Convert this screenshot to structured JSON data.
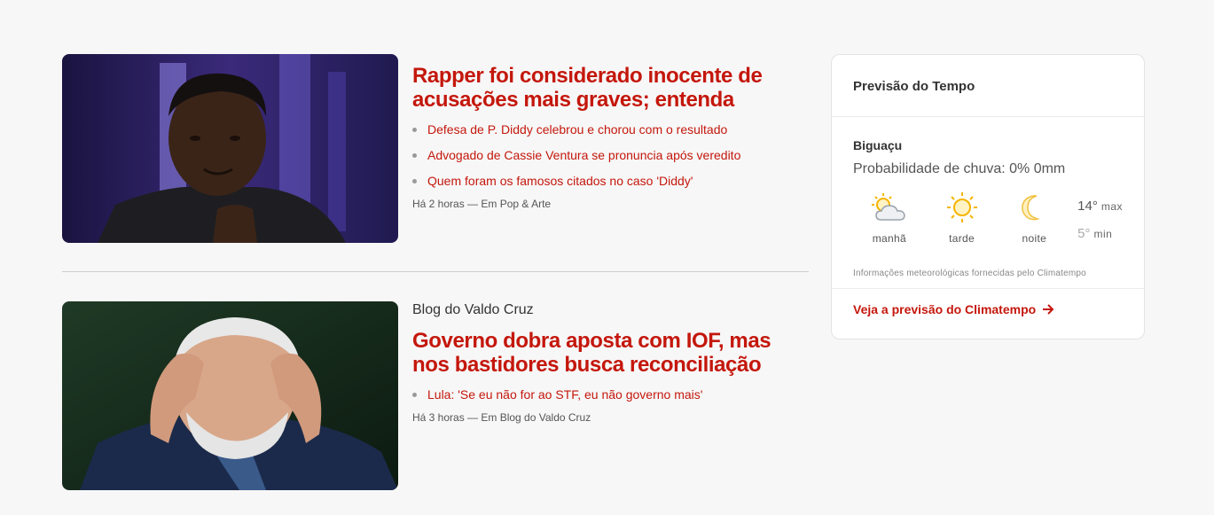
{
  "feed": {
    "posts": [
      {
        "headline": "Rapper foi considerado inocente de acusações mais graves; entenda",
        "related": [
          "Defesa de P. Diddy celebrou e chorou com o resultado",
          "Advogado de Cassie Ventura se pronuncia após veredito",
          "Quem foram os famosos citados no caso 'Diddy'"
        ],
        "meta": "Há 2 horas — Em Pop & Arte"
      },
      {
        "kicker": "Blog do Valdo Cruz",
        "headline": "Governo dobra aposta com IOF, mas nos bastidores busca reconciliação",
        "related": [
          "Lula: 'Se eu não for ao STF, eu não governo mais'"
        ],
        "meta": "Há 3 horas — Em Blog do Valdo Cruz"
      }
    ]
  },
  "weather": {
    "title": "Previsão do Tempo",
    "city": "Biguaçu",
    "rain": "Probabilidade de chuva: 0% 0mm",
    "periods": [
      {
        "label": "manhã",
        "icon": "partly-cloudy-icon"
      },
      {
        "label": "tarde",
        "icon": "sun-icon"
      },
      {
        "label": "noite",
        "icon": "moon-icon"
      }
    ],
    "temp_max": "14°",
    "temp_max_label": "max",
    "temp_min": "5°",
    "temp_min_label": "min",
    "credit": "Informações meteorológicas fornecidas pelo Climatempo",
    "link": "Veja a previsão do Climatempo"
  },
  "colors": {
    "accent": "#c4170c",
    "background": "#f7f7f7",
    "sun": "#f5b400"
  }
}
